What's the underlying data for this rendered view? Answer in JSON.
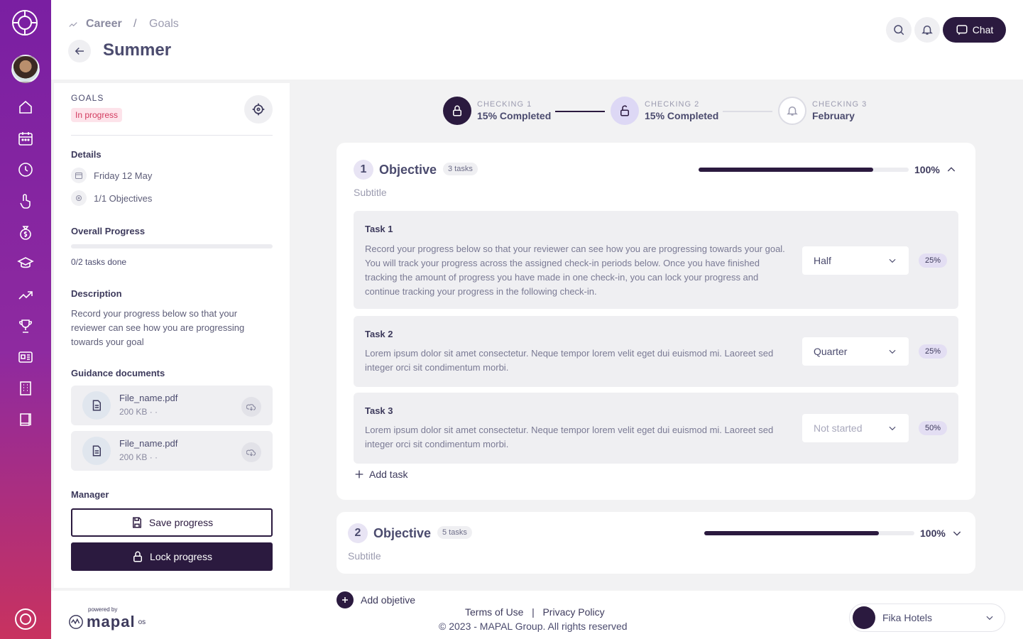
{
  "breadcrumb": {
    "parent": "Career",
    "separator": "/",
    "current": "Goals"
  },
  "page": {
    "title": "Summer"
  },
  "header": {
    "chat_label": "Chat"
  },
  "left_panel": {
    "section_label": "GOALS",
    "status": "In progress",
    "details_heading": "Details",
    "date": "Friday 12 May",
    "objectives_count": "1/1 Objectives",
    "overall_heading": "Overall Progress",
    "overall_progress_fraction": 0,
    "tasks_done": "0/2 tasks done",
    "description_heading": "Description",
    "description": "Record your progress below so that your reviewer can see how you are progressing towards your goal",
    "guidance_heading": "Guidance documents",
    "files": [
      {
        "name": "File_name.pdf",
        "size": "200 KB  ·  ·"
      },
      {
        "name": "File_name.pdf",
        "size": "200 KB  ·  ·"
      }
    ],
    "manager_heading": "Manager",
    "save_label": "Save progress",
    "lock_label": "Lock progress"
  },
  "steps": [
    {
      "label": "CHECKING 1",
      "value": "15% Completed",
      "state": "locked"
    },
    {
      "label": "CHECKING 2",
      "value": "15% Completed",
      "state": "unlocked"
    },
    {
      "label": "CHECKING 3",
      "value": "February",
      "state": "pending"
    }
  ],
  "objectives": [
    {
      "number": "1",
      "title": "Objective",
      "tasks_badge": "3 tasks",
      "progress_fraction": 0.83,
      "percent": "100%",
      "subtitle": "Subtitle",
      "tasks": [
        {
          "title": "Task 1",
          "desc": "Record your progress below so that your reviewer can see how you are progressing towards your goal.  You will track your progress across the assigned check-in periods below.  Once you have finished tracking the amount of progress you have made in one check-in, you can lock your progress and continue tracking your progress in the following check-in.",
          "select": "Half",
          "pct": "25%"
        },
        {
          "title": "Task 2",
          "desc": "Lorem ipsum dolor sit amet consectetur. Neque tempor lorem velit eget dui euismod mi. Laoreet sed integer orci sit condimentum morbi.",
          "select": "Quarter",
          "pct": "25%"
        },
        {
          "title": "Task 3",
          "desc": "Lorem ipsum dolor sit amet consectetur. Neque tempor lorem velit eget dui euismod mi. Laoreet sed integer orci sit condimentum morbi.",
          "select": "Not started",
          "pct": "50%"
        }
      ],
      "add_task": "Add task"
    },
    {
      "number": "2",
      "title": "Objective",
      "tasks_badge": "5 tasks",
      "progress_fraction": 0.83,
      "percent": "100%",
      "subtitle": "Subtitle"
    }
  ],
  "add_objective": "Add objetive",
  "footer": {
    "powered_by": "powered by",
    "brand": "mapal",
    "brand_suffix": "os",
    "terms": "Terms of Use",
    "link_sep": "|",
    "privacy": "Privacy Policy",
    "copyright": "© 2023 - MAPAL Group. All rights reserved",
    "company": "Fika Hotels"
  },
  "colors": {
    "accent": "#2b1a3f",
    "status_bg": "#fde3ea",
    "status_text": "#d23b5f",
    "sidebar_top": "#7a1fa2",
    "sidebar_bottom": "#c8325f"
  },
  "icons": [
    "home-icon",
    "calendar-icon",
    "history-icon",
    "touch-icon",
    "money-icon",
    "graduation-icon",
    "trend-icon",
    "trophy-icon",
    "news-icon",
    "building-icon",
    "book-icon"
  ]
}
